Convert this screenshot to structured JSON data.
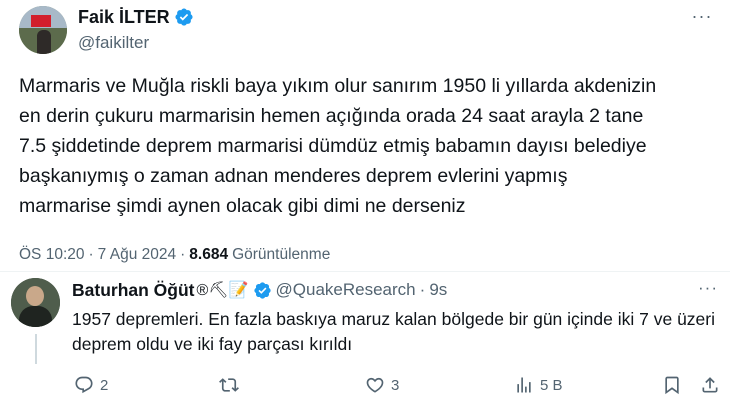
{
  "main_tweet": {
    "author_name": "Faik İLTER",
    "handle": "@faikilter",
    "text": "Marmaris ve Muğla riskli baya yıkım olur sanırım 1950 li yıllarda akdenizin\nen derin çukuru marmarisin hemen açığında orada 24 saat arayla 2 tane\n7.5 şiddetinde deprem marmarisi dümdüz etmiş babamın dayısı belediye\nbaşkanıymış o zaman adnan menderes deprem evlerini yapmış\nmarmarise şimdi aynen olacak gibi dimi ne derseniz",
    "time": "ÖS 10:20",
    "separator": "·",
    "date": "7 Ağu 2024",
    "views_count": "8.684",
    "views_label": "Görüntülenme",
    "more_label": "···"
  },
  "reply": {
    "author_name": "Baturhan Öğüt",
    "emojis": "®⛏📝",
    "handle": "@QuakeResearch",
    "separator": "·",
    "time": "9s",
    "text": "1957 depremleri. En fazla baskıya maruz kalan bölgede bir gün içinde iki 7 ve üzeri deprem oldu ve iki fay parçası kırıldı",
    "more_label": "···",
    "actions": {
      "reply_count": "2",
      "retweet_count": "",
      "like_count": "3",
      "views_count": "5 B"
    }
  },
  "colors": {
    "text": "#0f1419",
    "secondary": "#536471",
    "verified": "#1d9bf0",
    "divider": "#eff3f4"
  },
  "icons": [
    "verified-badge-icon",
    "more-icon",
    "reply-icon",
    "retweet-icon",
    "like-icon",
    "views-icon",
    "bookmark-icon",
    "share-icon"
  ]
}
